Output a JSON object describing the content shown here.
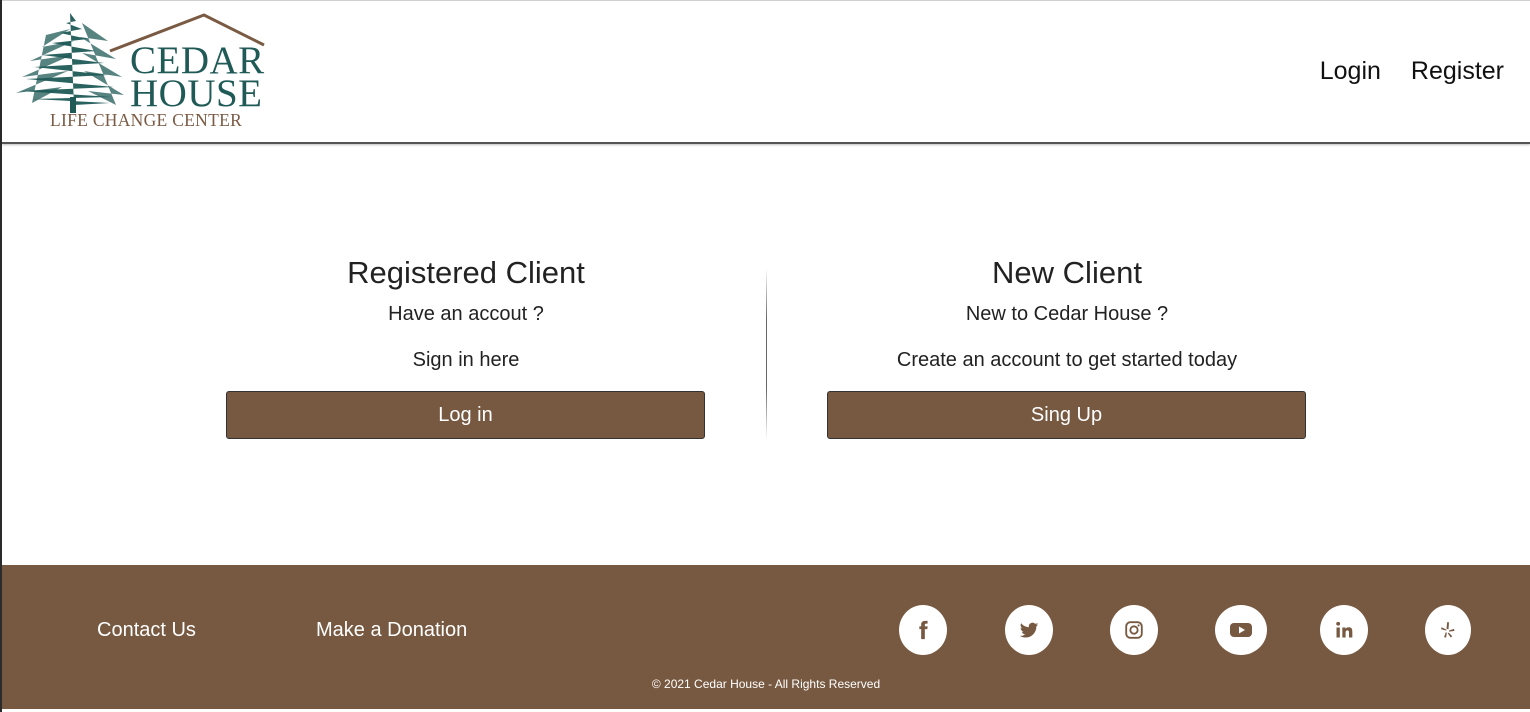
{
  "brand": {
    "logo_line1": "CEDAR",
    "logo_line2": "HOUSE",
    "tagline": "LIFE CHANGE CENTER",
    "colors": {
      "logo_green": "#1f5a57",
      "logo_brown": "#7a5a43"
    }
  },
  "nav": {
    "login": "Login",
    "register": "Register"
  },
  "registered": {
    "title": "Registered Client",
    "subtitle": "Have an accout ?",
    "description": "Sign in here",
    "button": "Log in"
  },
  "new_client": {
    "title": "New Client",
    "subtitle": "New to Cedar House ?",
    "description": "Create an account to get started today",
    "button": "Sing Up"
  },
  "footer": {
    "contact": "Contact Us",
    "donate": "Make a Donation",
    "social": [
      "facebook-icon",
      "twitter-icon",
      "instagram-icon",
      "youtube-icon",
      "linkedin-icon",
      "yelp-icon"
    ],
    "copyright": "© 2021 Cedar House - All Rights Reserved"
  },
  "theme": {
    "accent_brown": "#775841",
    "footer_bg": "#775941",
    "text_dark": "#222222"
  }
}
